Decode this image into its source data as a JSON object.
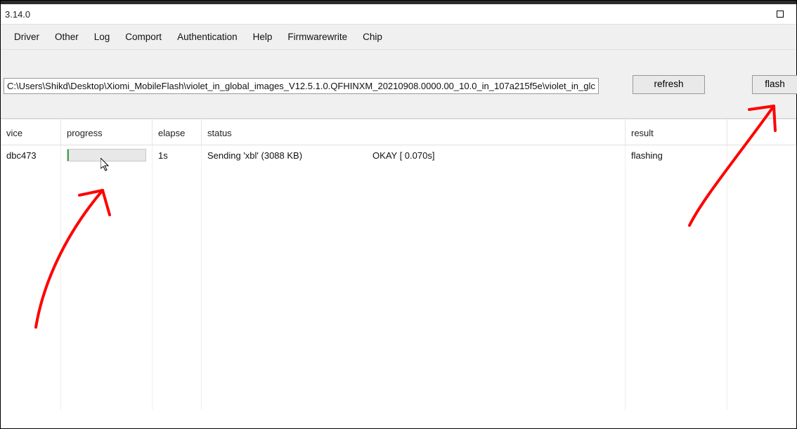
{
  "window": {
    "title": "3.14.0"
  },
  "menu": {
    "items": [
      "Driver",
      "Other",
      "Log",
      "Comport",
      "Authentication",
      "Help",
      "Firmwarewrite",
      "Chip"
    ]
  },
  "toolbar": {
    "path_value": "C:\\Users\\Shikd\\Desktop\\Xiomi_MobileFlash\\violet_in_global_images_V12.5.1.0.QFHINXM_20210908.0000.00_10.0_in_107a215f5e\\violet_in_glc",
    "refresh_label": "refresh",
    "flash_label": "flash"
  },
  "columns": {
    "device": "vice",
    "progress": "progress",
    "elapse": "elapse",
    "status": "status",
    "result": "result"
  },
  "row": {
    "device": "dbc473",
    "elapse": "1s",
    "status_line1": "Sending 'xbl' (3088 KB)",
    "status_line2": "OKAY [  0.070s]",
    "result": "flashing"
  }
}
